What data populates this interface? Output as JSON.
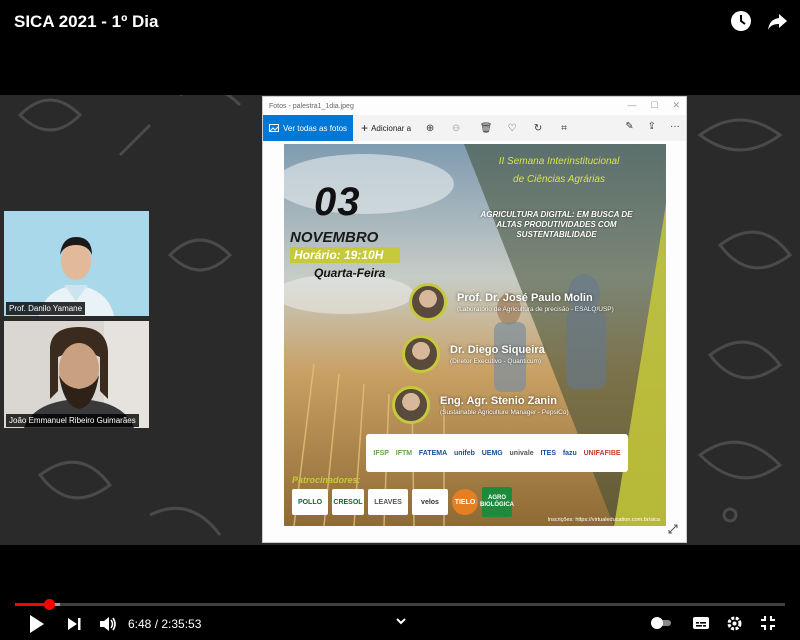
{
  "header": {
    "title": "SICA 2021 - 1º Dia"
  },
  "participants": [
    {
      "name": "Prof. Danilo Yamane"
    },
    {
      "name": "João Emmanuel Ribeiro Guimarães"
    }
  ],
  "photos_window": {
    "title": "Fotos - palestra1_1dia.jpeg",
    "see_all_label": "Ver todas as fotos",
    "add_to_label": "Adicionar a"
  },
  "poster": {
    "day": "03",
    "month": "NOVEMBRO",
    "time": "Horário: 19:10H",
    "weekday": "Quarta-Feira",
    "event_line1": "II Semana Interinstitucional",
    "event_line2": "de Ciências Agrárias",
    "theme_line1": "AGRICULTURA DIGITAL: EM BUSCA DE",
    "theme_line2": "ALTAS PRODUTIVIDADES COM",
    "theme_line3": "SUSTENTABILIDADE",
    "speakers": [
      {
        "name": "Prof. Dr. José Paulo Molin",
        "role": "(Laboratório de Agricultura de precisão - ESALQ/USP)"
      },
      {
        "name": "Dr. Diego Siqueira",
        "role": "(Diretor Executivo - Quanticum)"
      },
      {
        "name": "Eng. Agr. Stenio Zanin",
        "role": "(Sustainable Agriculture Manager - PepsiCo)"
      }
    ],
    "logos": [
      "IFSP",
      "IFTM",
      "FATEMA",
      "unifeb",
      "UEMG",
      "univale",
      "ITES",
      "fazu",
      "UNIFAFIBE"
    ],
    "sponsors_label": "Patrocinadores:",
    "sponsors": [
      "POLLO",
      "CRESOL",
      "LEAVES",
      "velos",
      "TIELO",
      "AGRO BIOLÓGICA"
    ],
    "footer": "Inscrições: https://virtualeducation.com.br/sica"
  },
  "player": {
    "current_time": "6:48",
    "duration": "2:35:53",
    "time_display": "6:48 / 2:35:53",
    "progress_fraction": 0.0436,
    "buffer_fraction": 0.058
  },
  "colors": {
    "progress_red": "#ff0000",
    "poster_accent": "#c6c93a",
    "photos_blue": "#0078d7"
  }
}
